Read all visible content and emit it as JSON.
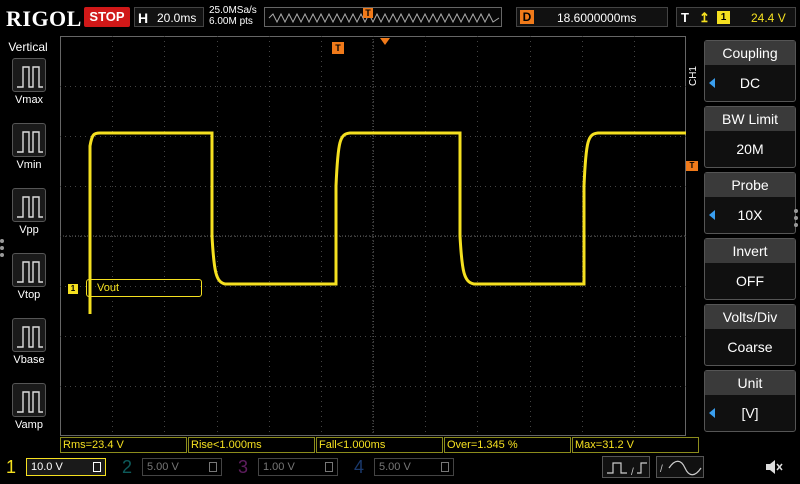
{
  "header": {
    "logo": "RIGOL",
    "run_state": "STOP",
    "horizontal": {
      "letter": "H",
      "timebase": "20.0ms"
    },
    "sample_rate": "25.0MSa/s",
    "memory_depth": "6.00M pts",
    "trigger_pos_letter": "T",
    "delay": {
      "letter": "D",
      "value": "18.6000000ms"
    },
    "trigger": {
      "letter": "T",
      "edge": "rising",
      "channel": "1",
      "level": "24.4 V"
    }
  },
  "left_panel": {
    "title": "Vertical",
    "items": [
      "Vmax",
      "Vmin",
      "Vpp",
      "Vtop",
      "Vbase",
      "Vamp"
    ]
  },
  "waveform": {
    "label_channel": "1",
    "label": "Vout",
    "trigger_marker": "T",
    "level_marker": "T",
    "color": "#f5e020"
  },
  "right_panel": {
    "channel_label": "CH1",
    "menus": [
      {
        "title": "Coupling",
        "value": "DC",
        "arrow": true
      },
      {
        "title": "BW Limit",
        "value": "20M",
        "arrow": false
      },
      {
        "title": "Probe",
        "value": "10X",
        "arrow": true
      },
      {
        "title": "Invert",
        "value": "OFF",
        "arrow": false
      },
      {
        "title": "Volts/Div",
        "value": "Coarse",
        "arrow": false
      },
      {
        "title": "Unit",
        "value": "[V]",
        "arrow": true
      }
    ]
  },
  "measurements": [
    "Rms=23.4 V",
    "Rise<1.000ms",
    "Fall<1.000ms",
    "Over=1.345 %",
    "Max=31.2 V"
  ],
  "channels": [
    {
      "number": "1",
      "scale": "10.0 V",
      "color": "#f5e020",
      "active": true
    },
    {
      "number": "2",
      "scale": "5.00 V",
      "color": "#1ec8c8",
      "active": false
    },
    {
      "number": "3",
      "scale": "1.00 V",
      "color": "#d040d0",
      "active": false
    },
    {
      "number": "4",
      "scale": "5.00 V",
      "color": "#3a7ff0",
      "active": false
    }
  ],
  "colors": {
    "accent": "#f07a1a",
    "ch1": "#f5e020",
    "menu_arrow": "#3a9ff0",
    "stop": "#d01818"
  }
}
